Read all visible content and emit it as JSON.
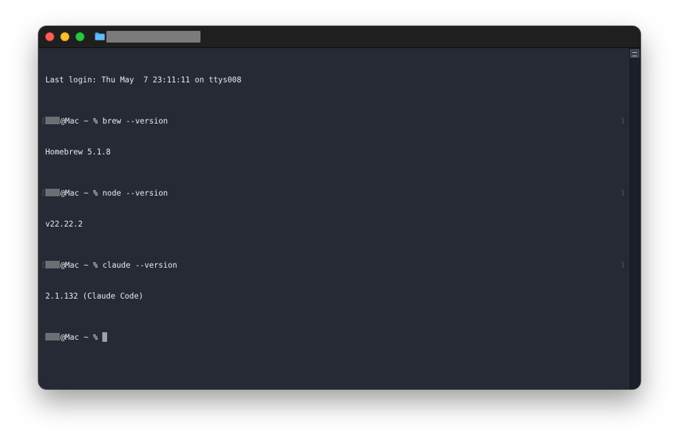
{
  "window": {
    "title": "",
    "colors": {
      "terminal_bg": "#262a35",
      "titlebar_bg": "#1f1f1f",
      "text": "#e9ecef",
      "close": "#fe5f57",
      "minimize": "#febc2e",
      "zoom": "#28c840"
    },
    "icons": {
      "folder": "folder-icon",
      "scroll_toggle": "scrollbar-toggle-icon"
    }
  },
  "terminal": {
    "last_login": "Last login: Thu May  7 23:11:11 on ttys008",
    "prompt_suffix": "@Mac ~ % ",
    "entries": [
      {
        "command": "brew --version",
        "output": "Homebrew 5.1.8"
      },
      {
        "command": "node --version",
        "output": "v22.22.2"
      },
      {
        "command": "claude --version",
        "output": "2.1.132 (Claude Code)"
      }
    ],
    "bracket_open": "[",
    "bracket_close": "]"
  }
}
